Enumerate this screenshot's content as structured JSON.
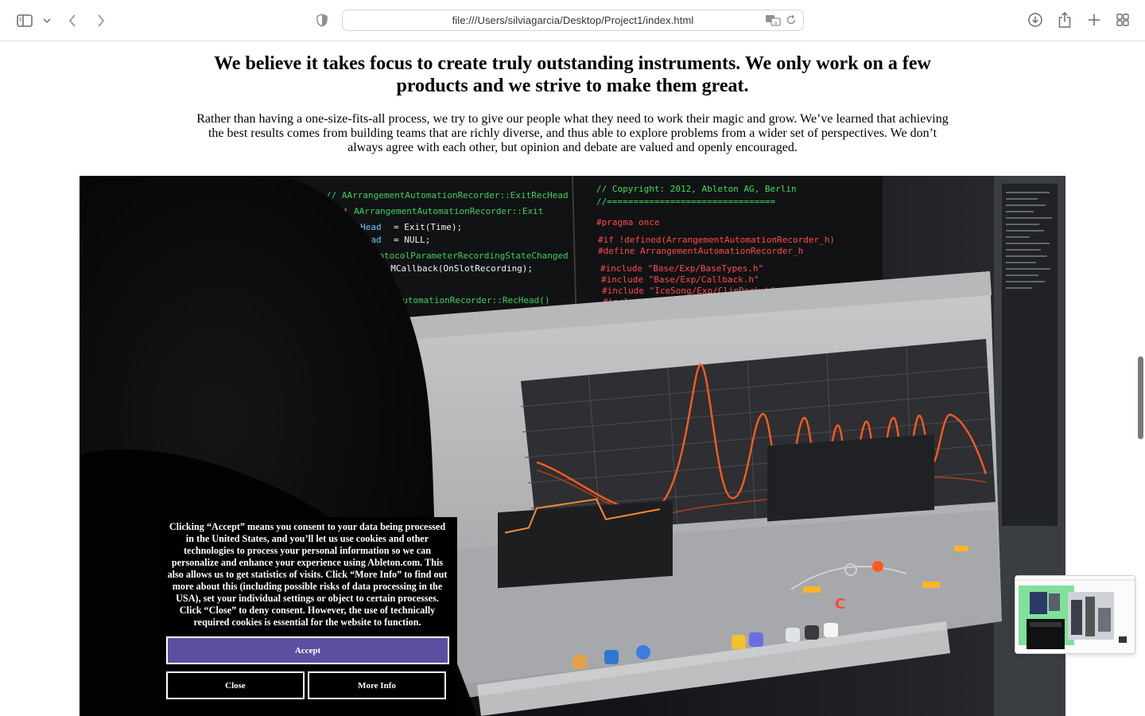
{
  "browser": {
    "url": "file:///Users/silviagarcia/Desktop/Project1/index.html",
    "icons": [
      "sidebar-icon",
      "chevron-down-icon",
      "back-icon",
      "forward-icon",
      "shield-icon",
      "translate-icon",
      "reload-icon",
      "download-icon",
      "share-icon",
      "new-tab-icon",
      "tab-overview-icon"
    ]
  },
  "page": {
    "headline": "We believe it takes focus to create truly outstanding instruments. We only work on a few products and we strive to make them great.",
    "body": "Rather than having a one-size-fits-all process, we try to give our people what they need to work their magic and grow. We’ve learned that achieving the best results comes from building teams that are richly diverse, and thus able to explore problems from a wider set of perspectives. We don’t always agree with each other, but opinion and debate are valued and openly encouraged."
  },
  "cookie_banner": {
    "text": "Clicking “Accept” means you consent to your data being processed in the United States, and you’ll let us use cookies and other technologies to process your personal information so we can personalize and enhance your experience using Ableton.com. This also allows us to get statistics of visits. Click “More Info” to find out more about this (including possible risks of data processing in the USA), set your individual settings or object to certain processes. Click “Close” to deny consent. However, the use of technically required cookies is essential for the website to function.",
    "accept_label": "Accept",
    "close_label": "Close",
    "more_info_label": "More Info",
    "accent_color": "#5b4fa0"
  },
  "colors": {
    "spectrum_orange": "#ff5a1f",
    "code_green": "#3ddc5a",
    "code_red": "#ff4a4a"
  }
}
